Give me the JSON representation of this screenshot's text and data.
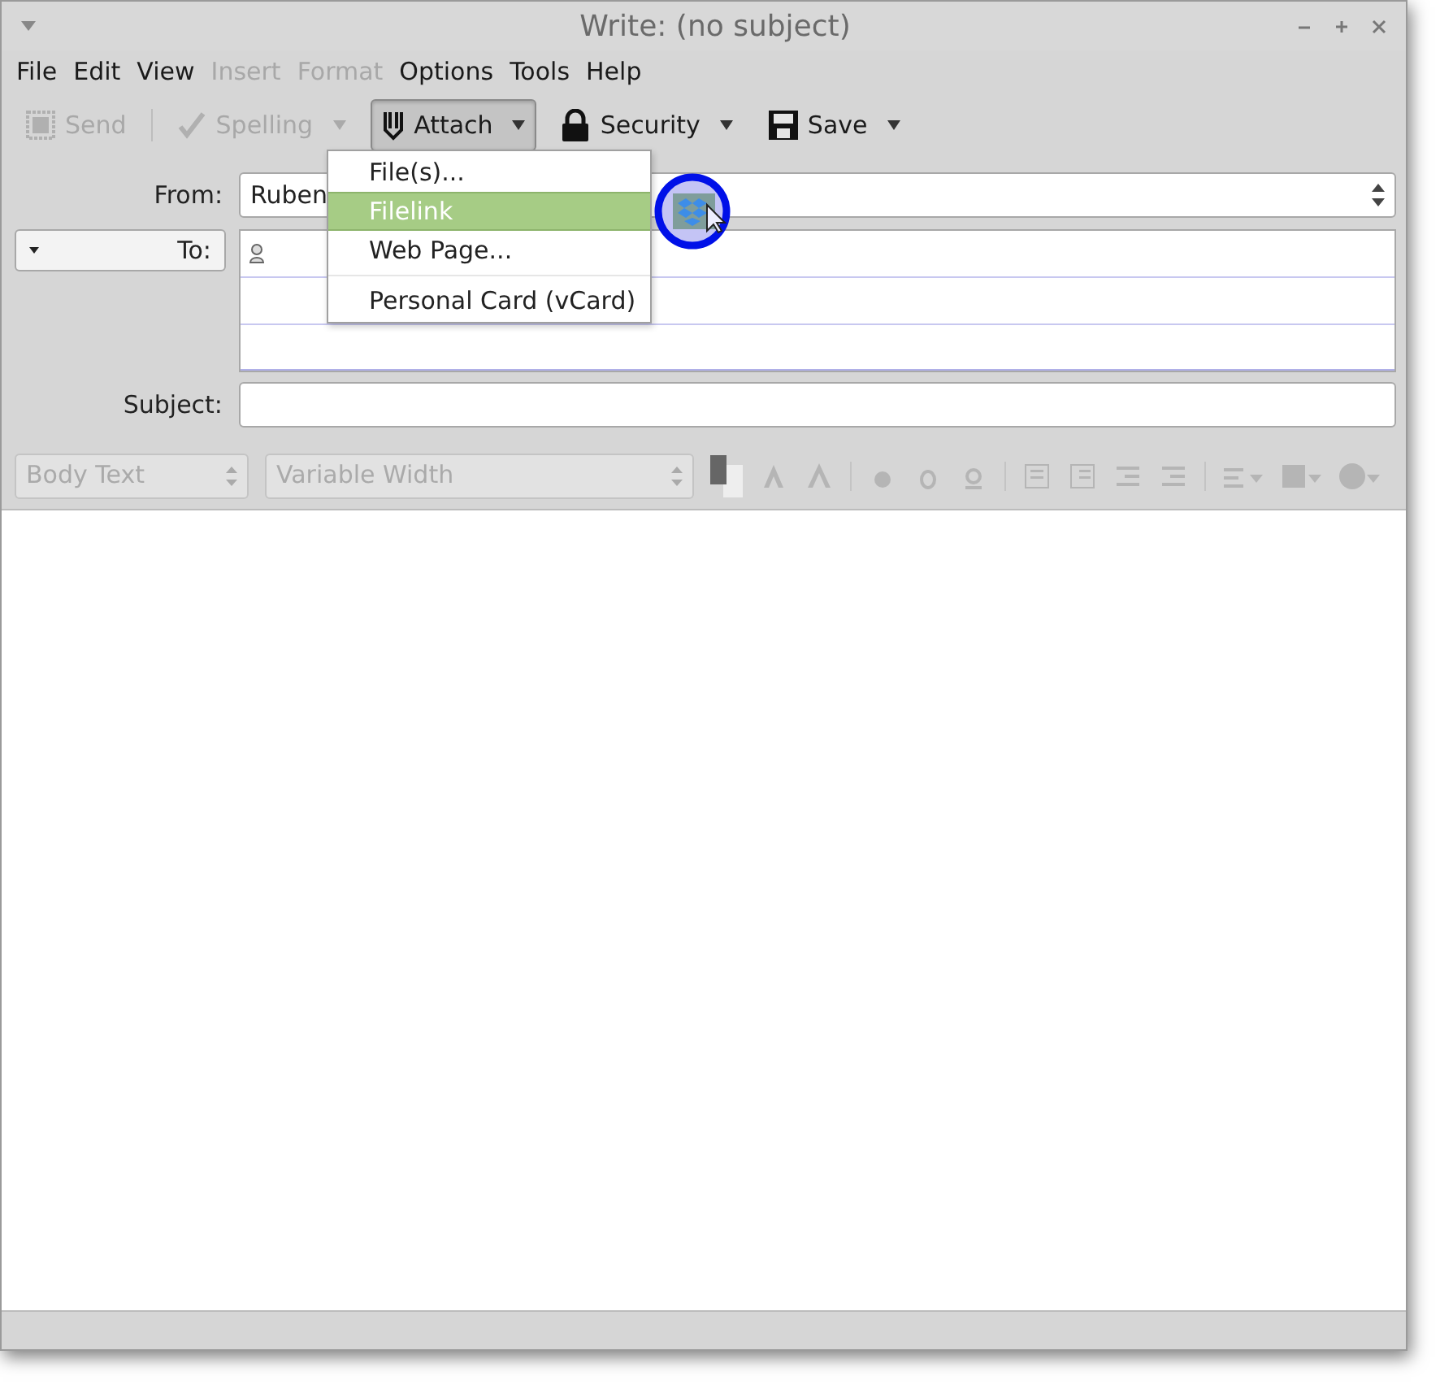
{
  "window": {
    "title": "Write: (no subject)"
  },
  "menu_bar": [
    {
      "label": "File",
      "disabled": false
    },
    {
      "label": "Edit",
      "disabled": false
    },
    {
      "label": "View",
      "disabled": false
    },
    {
      "label": "Insert",
      "disabled": true
    },
    {
      "label": "Format",
      "disabled": true
    },
    {
      "label": "Options",
      "disabled": false
    },
    {
      "label": "Tools",
      "disabled": false
    },
    {
      "label": "Help",
      "disabled": false
    }
  ],
  "toolbar": [
    {
      "kind": "send",
      "label": "Send",
      "disabled": true,
      "dropdown": false,
      "pressed": false
    },
    {
      "kind": "spelling",
      "label": "Spelling",
      "disabled": true,
      "dropdown": true,
      "pressed": false
    },
    {
      "kind": "attach",
      "label": "Attach",
      "disabled": false,
      "dropdown": true,
      "pressed": true
    },
    {
      "kind": "security",
      "label": "Security",
      "disabled": false,
      "dropdown": true,
      "pressed": false
    },
    {
      "kind": "save",
      "label": "Save",
      "disabled": false,
      "dropdown": true,
      "pressed": false
    }
  ],
  "attach_menu": [
    {
      "label": "File(s)...",
      "selected": false,
      "separator_before": false
    },
    {
      "label": "Filelink",
      "selected": true,
      "separator_before": false
    },
    {
      "label": "Web Page...",
      "selected": false,
      "separator_before": false
    },
    {
      "label": "Personal Card (vCard)",
      "selected": false,
      "separator_before": true
    }
  ],
  "from": {
    "label": "From:",
    "value": "Ruben"
  },
  "to": {
    "label": "To:"
  },
  "subject": {
    "label": "Subject:"
  },
  "format_bar": {
    "paragraph": "Body Text",
    "font": "Variable Width"
  }
}
